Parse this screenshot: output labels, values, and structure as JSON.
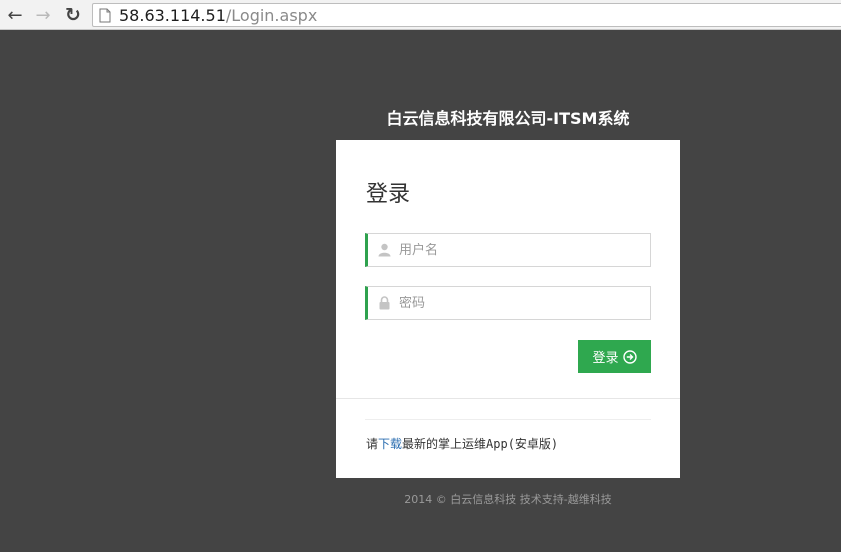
{
  "browser": {
    "url_host": "58.63.114.51",
    "url_path": "/Login.aspx",
    "back_icon": "arrow-left-icon",
    "forward_icon": "arrow-right-icon",
    "reload_icon": "reload-icon"
  },
  "site_title": "白云信息科技有限公司-ITSM系统",
  "login": {
    "heading": "登录",
    "username_placeholder": "用户名",
    "password_placeholder": "密码",
    "submit_label": "登录"
  },
  "download": {
    "prefix": "请",
    "link_text": "下载",
    "suffix": "最新的掌上运维App(安卓版)"
  },
  "footer": "2014 © 白云信息科技 技术支持-越维科技",
  "colors": {
    "background": "#444444",
    "accent_green": "#2fa84f",
    "link_blue": "#2a6db0"
  }
}
